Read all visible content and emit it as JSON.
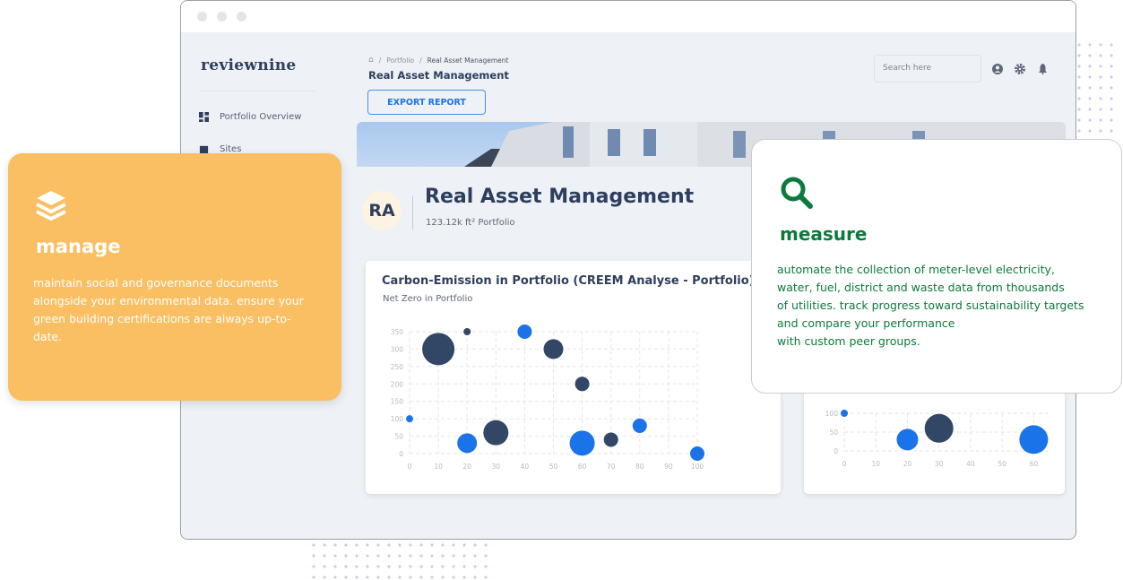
{
  "app": {
    "logo": "reviewnine"
  },
  "sidebar": {
    "items": [
      {
        "label": "Portfolio Overview",
        "icon": "dashboard-icon"
      },
      {
        "label": "Sites",
        "icon": "building-icon"
      }
    ]
  },
  "header": {
    "breadcrumb": [
      "Portfolio",
      "Real Asset Management"
    ],
    "title": "Real Asset Management",
    "export_label": "EXPORT REPORT",
    "search_placeholder": "Search here"
  },
  "portfolio": {
    "initials": "RA",
    "title": "Real Asset Management",
    "subtitle": "123.12k ft² Portfolio"
  },
  "colors": {
    "dark": "#324766",
    "blue": "#1a73e8",
    "manage_bg": "#f9bf62",
    "measure_green": "#0b7a3c"
  },
  "chart_data": [
    {
      "type": "scatter",
      "title": "Carbon-Emission in Portfolio (CREEM Analyse - Portfolio)",
      "subtitle": "Net Zero in Portfolio",
      "xlim": [
        0,
        100
      ],
      "ylim": [
        0,
        350
      ],
      "xticks": [
        0,
        10,
        20,
        30,
        40,
        50,
        60,
        70,
        80,
        90,
        100
      ],
      "yticks": [
        0,
        50,
        100,
        150,
        200,
        250,
        300,
        350
      ],
      "grid": true,
      "points": [
        {
          "x": 10,
          "y": 300,
          "size": 18,
          "c": "dark"
        },
        {
          "x": 20,
          "y": 350,
          "size": 4,
          "c": "dark"
        },
        {
          "x": 40,
          "y": 350,
          "size": 8,
          "c": "blue"
        },
        {
          "x": 50,
          "y": 300,
          "size": 11,
          "c": "dark"
        },
        {
          "x": 60,
          "y": 200,
          "size": 8,
          "c": "dark"
        },
        {
          "x": 0,
          "y": 100,
          "size": 4,
          "c": "blue"
        },
        {
          "x": 20,
          "y": 30,
          "size": 11,
          "c": "blue"
        },
        {
          "x": 30,
          "y": 60,
          "size": 14,
          "c": "dark"
        },
        {
          "x": 60,
          "y": 30,
          "size": 14,
          "c": "blue"
        },
        {
          "x": 70,
          "y": 40,
          "size": 8,
          "c": "dark"
        },
        {
          "x": 80,
          "y": 80,
          "size": 8,
          "c": "blue"
        },
        {
          "x": 100,
          "y": 0,
          "size": 8,
          "c": "blue"
        }
      ]
    },
    {
      "type": "scatter",
      "xlim": [
        0,
        65
      ],
      "ylim": [
        0,
        100
      ],
      "xticks": [
        0,
        10,
        20,
        30,
        40,
        50,
        60
      ],
      "yticks": [
        0,
        50,
        100
      ],
      "grid": true,
      "points": [
        {
          "x": 0,
          "y": 100,
          "size": 4,
          "c": "blue"
        },
        {
          "x": 20,
          "y": 30,
          "size": 12,
          "c": "blue"
        },
        {
          "x": 30,
          "y": 60,
          "size": 16,
          "c": "dark"
        },
        {
          "x": 60,
          "y": 30,
          "size": 16,
          "c": "blue"
        }
      ]
    }
  ],
  "manage": {
    "title": "manage",
    "text": "maintain social and governance documents alongside your environmental data. ensure your green building certifications are always up-to-date."
  },
  "measure": {
    "title": "measure",
    "lines": [
      "automate the collection of meter-level electricity,",
      "water, fuel, district and waste data from thousands",
      "of utilities. track progress toward sustainability targets",
      "and compare your performance",
      "with custom peer groups."
    ]
  }
}
